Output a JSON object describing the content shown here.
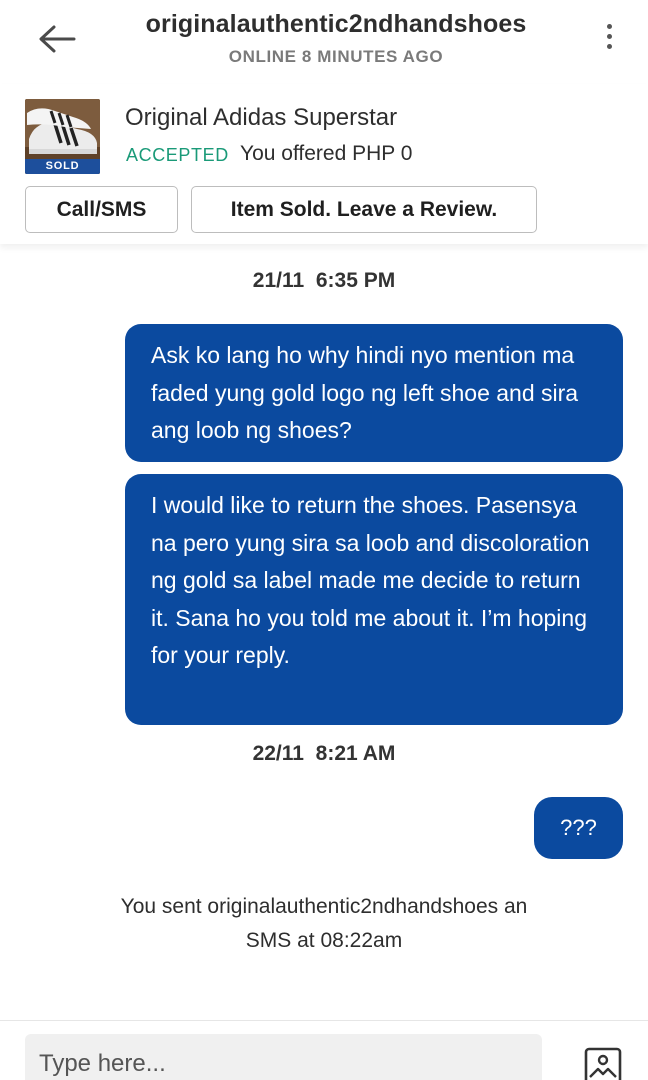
{
  "header": {
    "back_icon": "arrow-left-icon",
    "username": "originalauthentic2ndhandshoes",
    "status": "ONLINE 8 MINUTES AGO",
    "more_icon": "more-vertical-icon"
  },
  "listing": {
    "title": "Original Adidas Superstar",
    "sold_label": "SOLD",
    "offer_status": "ACCEPTED",
    "offer_text": "You offered PHP 0",
    "call_button": "Call/SMS",
    "review_button": "Item Sold. Leave a Review."
  },
  "chat": {
    "messages": [
      {
        "date": "21/11",
        "time": "6:35 PM"
      },
      {
        "text": "Ask ko lang ho why hindi nyo mention ma faded yung gold logo ng left shoe and sira ang loob ng shoes?"
      },
      {
        "text": "I would like to return the shoes. Pasensya na pero yung sira sa loob and discoloration ng gold sa label made me decide to return it. Sana ho you told me about it. I’m hoping for your reply."
      },
      {
        "date": "22/11",
        "time": "8:21 AM"
      },
      {
        "text": "???"
      }
    ],
    "sms_note": "You sent originalauthentic2ndhandshoes an SMS at 08:22am"
  },
  "composer": {
    "placeholder": "Type here...",
    "photo_icon": "image-upload-icon"
  },
  "colors": {
    "bubble": "#0b4a9f",
    "accepted": "#1a9a78",
    "sold_tag": "#1d4f9c"
  }
}
